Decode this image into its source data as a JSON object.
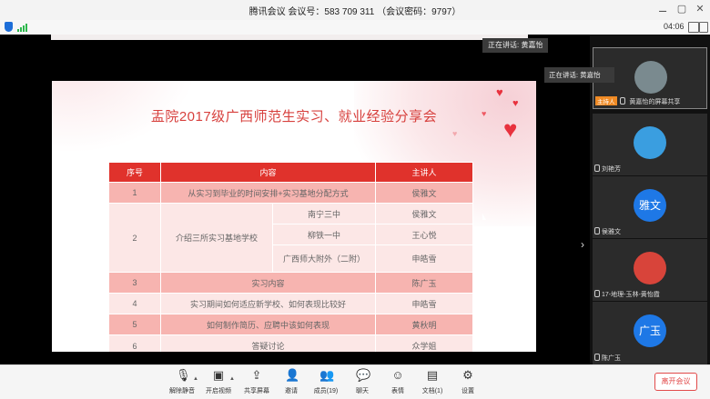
{
  "window": {
    "title": "腾讯会议  会议号：583 709 311  （会议密码：9797）",
    "controls": [
      "⚊",
      "▢",
      "✕"
    ]
  },
  "status": {
    "timer": "04:06"
  },
  "main": {
    "speaking_tag": "正在讲话: 黄嘉怡",
    "speaking_popup": "正在讲话: 黄嘉怡",
    "slide": {
      "title": "盂院2017级广西师范生实习、就业经验分享会",
      "headers": [
        "序号",
        "内容",
        "主讲人"
      ],
      "rows": {
        "r1": {
          "no": "1",
          "content": "从实习到毕业的时间安排+实习基地分配方式",
          "speaker": "侯雅文"
        },
        "r2": {
          "no": "2",
          "content": "介绍三所实习基地学校",
          "sub": [
            {
              "school": "南宁三中",
              "speaker": "侯雅文"
            },
            {
              "school": "柳铁一中",
              "speaker": "王心悦"
            },
            {
              "school": "广西师大附外（二附）",
              "speaker": "申皓雪"
            }
          ]
        },
        "r3": {
          "no": "3",
          "content": "实习内容",
          "speaker": "陈广玉"
        },
        "r4": {
          "no": "4",
          "content": "实习期间如何适应新学校、如何表现比较好",
          "speaker": "申皓雪"
        },
        "r5": {
          "no": "5",
          "content": "如何制作简历、应聘中该如何表现",
          "speaker": "黄秋明"
        },
        "r6": {
          "no": "6",
          "content": "答疑讨论",
          "speaker": "众学姐"
        }
      }
    }
  },
  "participants": [
    {
      "host_badge": "主持人",
      "name": "黄嘉怡的屏幕共享",
      "avatar_text": "",
      "color": "#7a8a8f"
    },
    {
      "name": "刘艳芳",
      "avatar_text": "",
      "color": "#3a9ee0"
    },
    {
      "name": "侯雅文",
      "avatar_text": "雅文",
      "color": "#1e78e6"
    },
    {
      "name": "17-地理-玉林-黄怡霞",
      "avatar_text": "",
      "color": "#d8443a"
    },
    {
      "name": "陈广玉",
      "avatar_text": "广玉",
      "color": "#1e78e6"
    }
  ],
  "toolbar": {
    "items": [
      {
        "label": "解除静音",
        "icon": "mic-off-icon"
      },
      {
        "label": "开启视频",
        "icon": "video-off-icon"
      },
      {
        "label": "共享屏幕",
        "icon": "share-screen-icon"
      },
      {
        "label": "邀请",
        "icon": "invite-icon"
      },
      {
        "label": "成员(19)",
        "icon": "members-icon"
      },
      {
        "label": "聊天",
        "icon": "chat-icon"
      },
      {
        "label": "表情",
        "icon": "emoji-icon"
      },
      {
        "label": "文档(1)",
        "icon": "document-icon"
      },
      {
        "label": "设置",
        "icon": "settings-icon"
      }
    ],
    "leave_label": "离开会议"
  }
}
